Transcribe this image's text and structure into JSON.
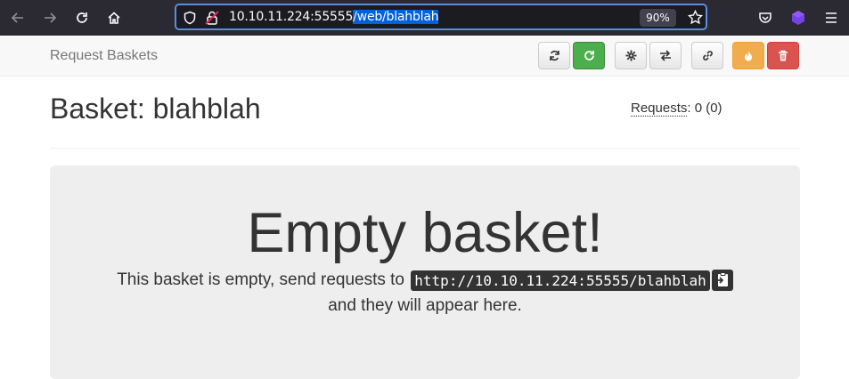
{
  "browser": {
    "url_host": "10.10.11.224:55555",
    "url_path": "/web/blahblah",
    "zoom": "90%",
    "icons": [
      "back-arrow-icon",
      "forward-arrow-icon",
      "reload-icon",
      "home-icon",
      "shield-icon",
      "insecure-lock-icon",
      "bookmark-star-icon",
      "pocket-icon",
      "extension-icon",
      "menu-icon"
    ]
  },
  "navbar": {
    "brand": "Request Baskets",
    "buttons": [
      "refresh-icon",
      "auto-refresh-icon",
      "settings-icon",
      "responses-icon",
      "link-icon",
      "fire-icon",
      "trash-icon"
    ],
    "colors": {
      "green": "#4cae4c",
      "orange": "#f0ad4e",
      "red": "#d9534f"
    }
  },
  "basket": {
    "title": "Basket: blahblah",
    "requests_label": "Requests",
    "requests_count": ": 0 (0)"
  },
  "empty": {
    "heading": "Empty basket!",
    "line1_prefix": "This basket is empty, send requests to",
    "basket_url": "http://10.10.11.224:55555/blahblah",
    "line2": "and they will appear here."
  }
}
